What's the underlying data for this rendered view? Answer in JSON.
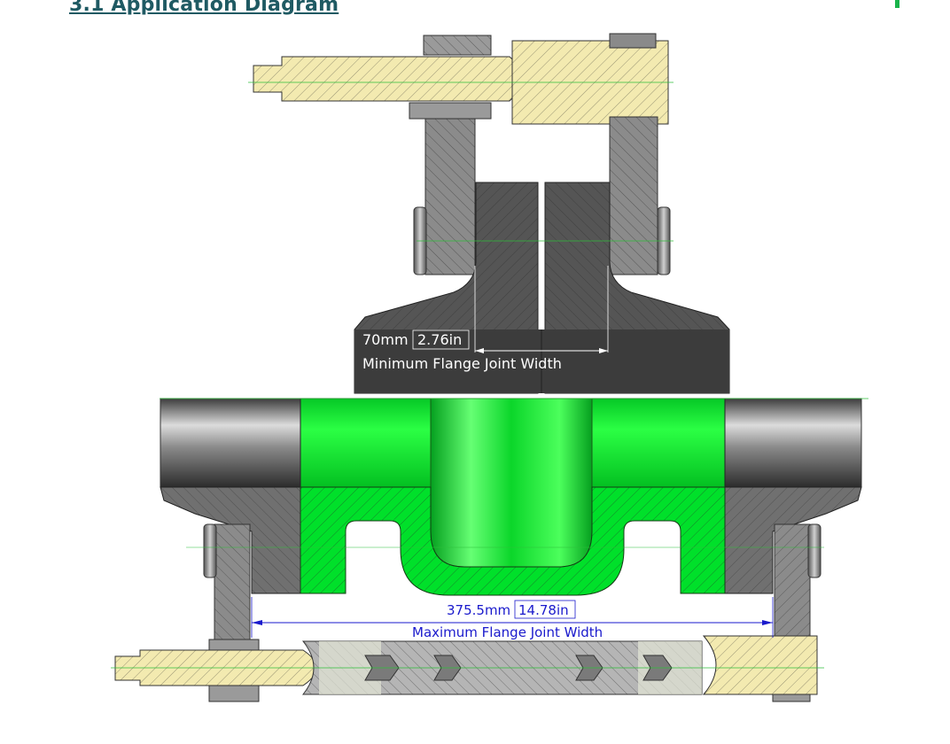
{
  "heading": {
    "text": "3.1 Application Diagram"
  },
  "min_dimension": {
    "value_mm": "70mm",
    "value_in": "2.76in",
    "caption": "Minimum Flange Joint Width"
  },
  "max_dimension": {
    "value_mm": "375.5mm",
    "value_in": "14.78in",
    "caption": "Maximum Flange Joint Width"
  },
  "colors": {
    "heading": "#1f5a63",
    "accent_green": "#19b34a",
    "highlight_green": "#00e02a",
    "steel_dark": "#5a5a5a",
    "steel_light": "#a6a6a6",
    "brass": "#f3eab0",
    "dimension_blue": "#1a1acc"
  }
}
